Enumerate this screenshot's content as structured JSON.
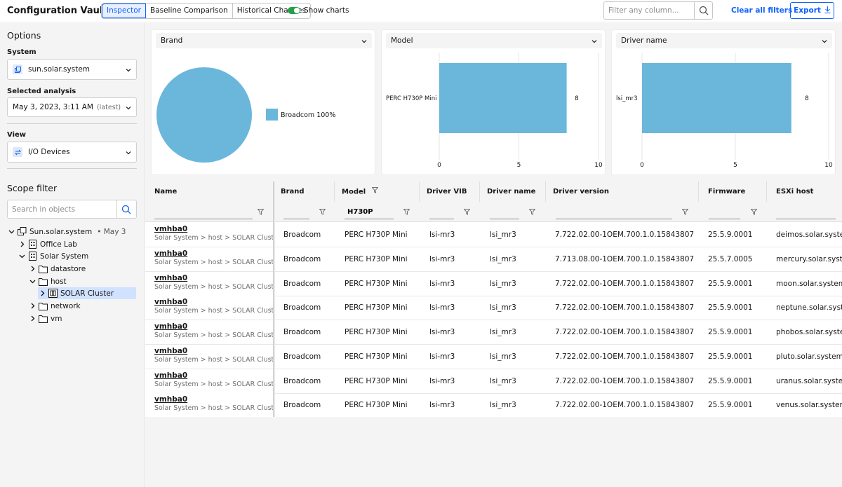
{
  "app": {
    "title": "Configuration Vault"
  },
  "tabs": [
    {
      "label": "Inspector"
    },
    {
      "label": "Baseline Comparison"
    },
    {
      "label": "Historical Changes"
    }
  ],
  "toolbar": {
    "show_charts_label": "Show charts",
    "show_charts_on": true,
    "filter_placeholder": "Filter any column...",
    "clear_filters": "Clear all filters",
    "export": "Export"
  },
  "sidebar": {
    "options_heading": "Options",
    "system_label": "System",
    "system_value": "sun.solar.system",
    "analysis_label": "Selected analysis",
    "analysis_value": "May 3, 2023, 3:11 AM",
    "analysis_tag": "(latest)",
    "view_label": "View",
    "view_value": "I/O Devices",
    "scope_heading": "Scope filter",
    "scope_placeholder": "Search in objects",
    "tree": [
      {
        "label": "Sun.solar.system",
        "meta": "•  May 3",
        "icon": "system-icon",
        "expanded": true
      },
      {
        "label": "Office Lab",
        "icon": "building-icon",
        "expanded": false
      },
      {
        "label": "Solar System",
        "icon": "building-icon",
        "expanded": true
      },
      {
        "label": "datastore",
        "icon": "folder-icon",
        "expanded": false
      },
      {
        "label": "host",
        "icon": "folder-icon",
        "expanded": true
      },
      {
        "label": "SOLAR Cluster",
        "icon": "cluster-icon",
        "expanded": false,
        "selected": true
      },
      {
        "label": "network",
        "icon": "folder-icon",
        "expanded": false
      },
      {
        "label": "vm",
        "icon": "folder-icon",
        "expanded": false
      }
    ]
  },
  "charts": {
    "brand_select": "Brand",
    "model_select": "Model",
    "driver_select": "Driver name",
    "bar_color": "#6bb7dc"
  },
  "chart_data": [
    {
      "type": "pie",
      "labels": [
        "Broadcom"
      ],
      "values": [
        100
      ],
      "legend": [
        "Broadcom  100%"
      ]
    },
    {
      "type": "bar",
      "orientation": "horizontal",
      "categories": [
        "PERC H730P Mini"
      ],
      "values": [
        8
      ],
      "xlim": [
        0,
        10
      ],
      "xticks": [
        0,
        5,
        10
      ]
    },
    {
      "type": "bar",
      "orientation": "horizontal",
      "categories": [
        "lsi_mr3"
      ],
      "values": [
        8
      ],
      "xlim": [
        0,
        10
      ],
      "xticks": [
        0,
        5,
        10
      ]
    }
  ],
  "table": {
    "columns": [
      "Name",
      "Brand",
      "Model",
      "Driver VIB",
      "Driver name",
      "Driver version",
      "Firmware",
      "ESXi host"
    ],
    "model_filter": "H730P",
    "rows": [
      {
        "name": "vmhba0",
        "path": "Solar System > host > SOLAR Cluster > deimos.solar.system",
        "brand": "Broadcom",
        "model": "PERC H730P Mini",
        "vib": "lsi-mr3",
        "driver": "lsi_mr3",
        "version": "7.722.02.00-1OEM.700.1.0.15843807",
        "firmware": "25.5.9.0001",
        "host": "deimos.solar.system"
      },
      {
        "name": "vmhba0",
        "path": "Solar System > host > SOLAR Cluster > mercury.solar.system",
        "brand": "Broadcom",
        "model": "PERC H730P Mini",
        "vib": "lsi-mr3",
        "driver": "lsi_mr3",
        "version": "7.713.08.00-1OEM.700.1.0.15843807",
        "firmware": "25.5.7.0005",
        "host": "mercury.solar.system"
      },
      {
        "name": "vmhba0",
        "path": "Solar System > host > SOLAR Cluster > moon.solar.system",
        "brand": "Broadcom",
        "model": "PERC H730P Mini",
        "vib": "lsi-mr3",
        "driver": "lsi_mr3",
        "version": "7.722.02.00-1OEM.700.1.0.15843807",
        "firmware": "25.5.9.0001",
        "host": "moon.solar.system"
      },
      {
        "name": "vmhba0",
        "path": "Solar System > host > SOLAR Cluster > neptune.solar.system",
        "brand": "Broadcom",
        "model": "PERC H730P Mini",
        "vib": "lsi-mr3",
        "driver": "lsi_mr3",
        "version": "7.722.02.00-1OEM.700.1.0.15843807",
        "firmware": "25.5.9.0001",
        "host": "neptune.solar.system"
      },
      {
        "name": "vmhba0",
        "path": "Solar System > host > SOLAR Cluster > phobos.solar.system",
        "brand": "Broadcom",
        "model": "PERC H730P Mini",
        "vib": "lsi-mr3",
        "driver": "lsi_mr3",
        "version": "7.722.02.00-1OEM.700.1.0.15843807",
        "firmware": "25.5.9.0001",
        "host": "phobos.solar.system"
      },
      {
        "name": "vmhba0",
        "path": "Solar System > host > SOLAR Cluster > pluto.solar.system",
        "brand": "Broadcom",
        "model": "PERC H730P Mini",
        "vib": "lsi-mr3",
        "driver": "lsi_mr3",
        "version": "7.722.02.00-1OEM.700.1.0.15843807",
        "firmware": "25.5.9.0001",
        "host": "pluto.solar.system"
      },
      {
        "name": "vmhba0",
        "path": "Solar System > host > SOLAR Cluster > uranus.solar.system",
        "brand": "Broadcom",
        "model": "PERC H730P Mini",
        "vib": "lsi-mr3",
        "driver": "lsi_mr3",
        "version": "7.722.02.00-1OEM.700.1.0.15843807",
        "firmware": "25.5.9.0001",
        "host": "uranus.solar.system"
      },
      {
        "name": "vmhba0",
        "path": "Solar System > host > SOLAR Cluster > venus.solar.system",
        "brand": "Broadcom",
        "model": "PERC H730P Mini",
        "vib": "lsi-mr3",
        "driver": "lsi_mr3",
        "version": "7.722.02.00-1OEM.700.1.0.15843807",
        "firmware": "25.5.9.0001",
        "host": "venus.solar.system"
      }
    ]
  }
}
